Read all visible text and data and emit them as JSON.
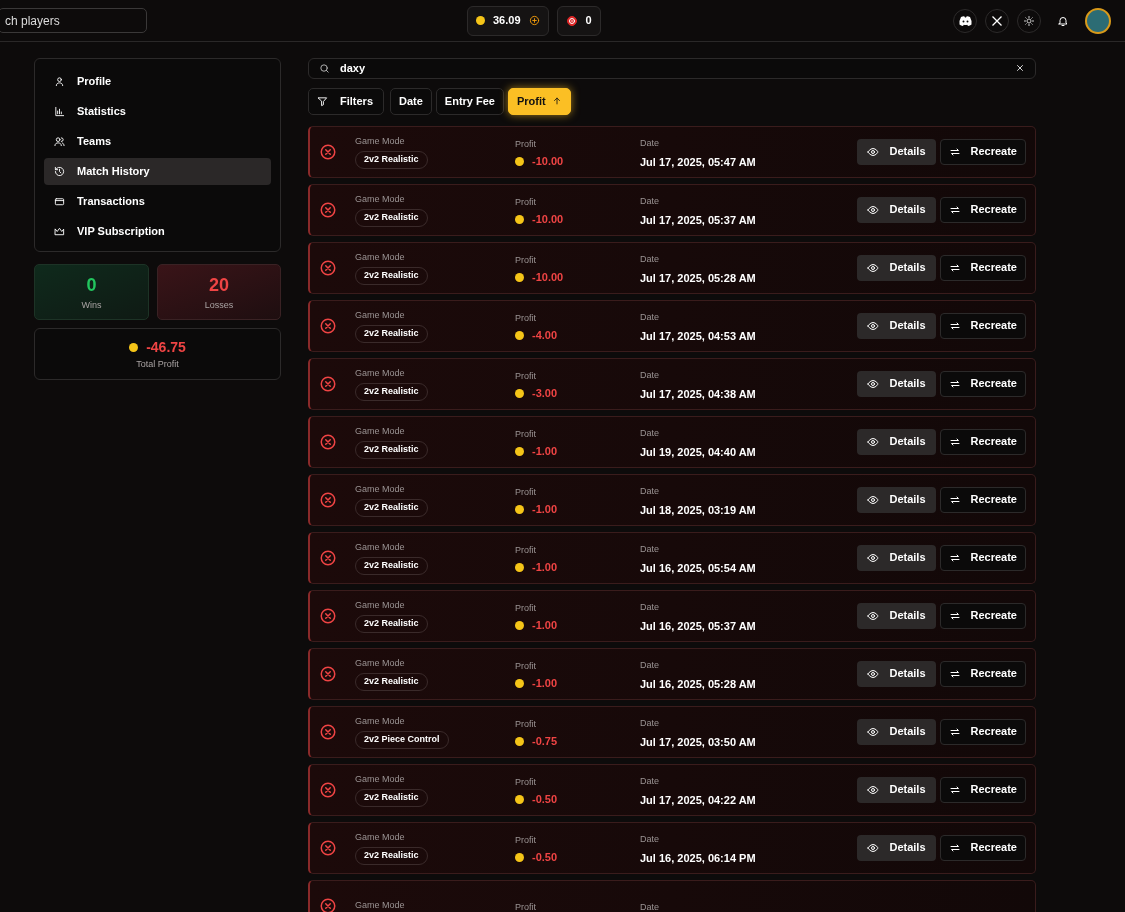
{
  "header": {
    "search": {
      "placeholder": "ch players"
    },
    "balance": "36.09",
    "tickets": "0"
  },
  "sidebar": {
    "items": [
      {
        "label": "Profile",
        "selected": false
      },
      {
        "label": "Statistics",
        "selected": false
      },
      {
        "label": "Teams",
        "selected": false
      },
      {
        "label": "Match History",
        "selected": true
      },
      {
        "label": "Transactions",
        "selected": false
      },
      {
        "label": "VIP Subscription",
        "selected": false
      }
    ]
  },
  "stats": {
    "wins": {
      "value": "0",
      "label": "Wins"
    },
    "losses": {
      "value": "20",
      "label": "Losses"
    },
    "total": {
      "value": "-46.75",
      "label": "Total Profit"
    }
  },
  "search": {
    "value": "daxy"
  },
  "sort_buttons": [
    {
      "label": "Filters",
      "kind": "filter",
      "selected": false
    },
    {
      "label": "Date",
      "kind": "sort",
      "selected": false
    },
    {
      "label": "Entry Fee",
      "kind": "sort",
      "selected": false
    },
    {
      "label": "Profit",
      "kind": "sort",
      "selected": true
    }
  ],
  "matches": [
    {
      "won": false,
      "mode_label": "Game Mode",
      "mode": "2v2 Realistic",
      "profit_label": "Profit",
      "profit": "-10.00",
      "date_label": "Date",
      "date": "Jul 17, 2025, 05:47 AM",
      "details": "Details",
      "recreate": "Recreate"
    },
    {
      "won": false,
      "mode_label": "Game Mode",
      "mode": "2v2 Realistic",
      "profit_label": "Profit",
      "profit": "-10.00",
      "date_label": "Date",
      "date": "Jul 17, 2025, 05:37 AM",
      "details": "Details",
      "recreate": "Recreate"
    },
    {
      "won": false,
      "mode_label": "Game Mode",
      "mode": "2v2 Realistic",
      "profit_label": "Profit",
      "profit": "-10.00",
      "date_label": "Date",
      "date": "Jul 17, 2025, 05:28 AM",
      "details": "Details",
      "recreate": "Recreate"
    },
    {
      "won": false,
      "mode_label": "Game Mode",
      "mode": "2v2 Realistic",
      "profit_label": "Profit",
      "profit": "-4.00",
      "date_label": "Date",
      "date": "Jul 17, 2025, 04:53 AM",
      "details": "Details",
      "recreate": "Recreate"
    },
    {
      "won": false,
      "mode_label": "Game Mode",
      "mode": "2v2 Realistic",
      "profit_label": "Profit",
      "profit": "-3.00",
      "date_label": "Date",
      "date": "Jul 17, 2025, 04:38 AM",
      "details": "Details",
      "recreate": "Recreate"
    },
    {
      "won": false,
      "mode_label": "Game Mode",
      "mode": "2v2 Realistic",
      "profit_label": "Profit",
      "profit": "-1.00",
      "date_label": "Date",
      "date": "Jul 19, 2025, 04:40 AM",
      "details": "Details",
      "recreate": "Recreate"
    },
    {
      "won": false,
      "mode_label": "Game Mode",
      "mode": "2v2 Realistic",
      "profit_label": "Profit",
      "profit": "-1.00",
      "date_label": "Date",
      "date": "Jul 18, 2025, 03:19 AM",
      "details": "Details",
      "recreate": "Recreate"
    },
    {
      "won": false,
      "mode_label": "Game Mode",
      "mode": "2v2 Realistic",
      "profit_label": "Profit",
      "profit": "-1.00",
      "date_label": "Date",
      "date": "Jul 16, 2025, 05:54 AM",
      "details": "Details",
      "recreate": "Recreate"
    },
    {
      "won": false,
      "mode_label": "Game Mode",
      "mode": "2v2 Realistic",
      "profit_label": "Profit",
      "profit": "-1.00",
      "date_label": "Date",
      "date": "Jul 16, 2025, 05:37 AM",
      "details": "Details",
      "recreate": "Recreate"
    },
    {
      "won": false,
      "mode_label": "Game Mode",
      "mode": "2v2 Realistic",
      "profit_label": "Profit",
      "profit": "-1.00",
      "date_label": "Date",
      "date": "Jul 16, 2025, 05:28 AM",
      "details": "Details",
      "recreate": "Recreate"
    },
    {
      "won": false,
      "mode_label": "Game Mode",
      "mode": "2v2 Piece Control",
      "profit_label": "Profit",
      "profit": "-0.75",
      "date_label": "Date",
      "date": "Jul 17, 2025, 03:50 AM",
      "details": "Details",
      "recreate": "Recreate"
    },
    {
      "won": false,
      "mode_label": "Game Mode",
      "mode": "2v2 Realistic",
      "profit_label": "Profit",
      "profit": "-0.50",
      "date_label": "Date",
      "date": "Jul 17, 2025, 04:22 AM",
      "details": "Details",
      "recreate": "Recreate"
    },
    {
      "won": false,
      "mode_label": "Game Mode",
      "mode": "2v2 Realistic",
      "profit_label": "Profit",
      "profit": "-0.50",
      "date_label": "Date",
      "date": "Jul 16, 2025, 06:14 PM",
      "details": "Details",
      "recreate": "Recreate"
    },
    {
      "won": false,
      "mode_label": "Game Mode",
      "profit_label": "Profit",
      "date_label": "Date"
    }
  ]
}
